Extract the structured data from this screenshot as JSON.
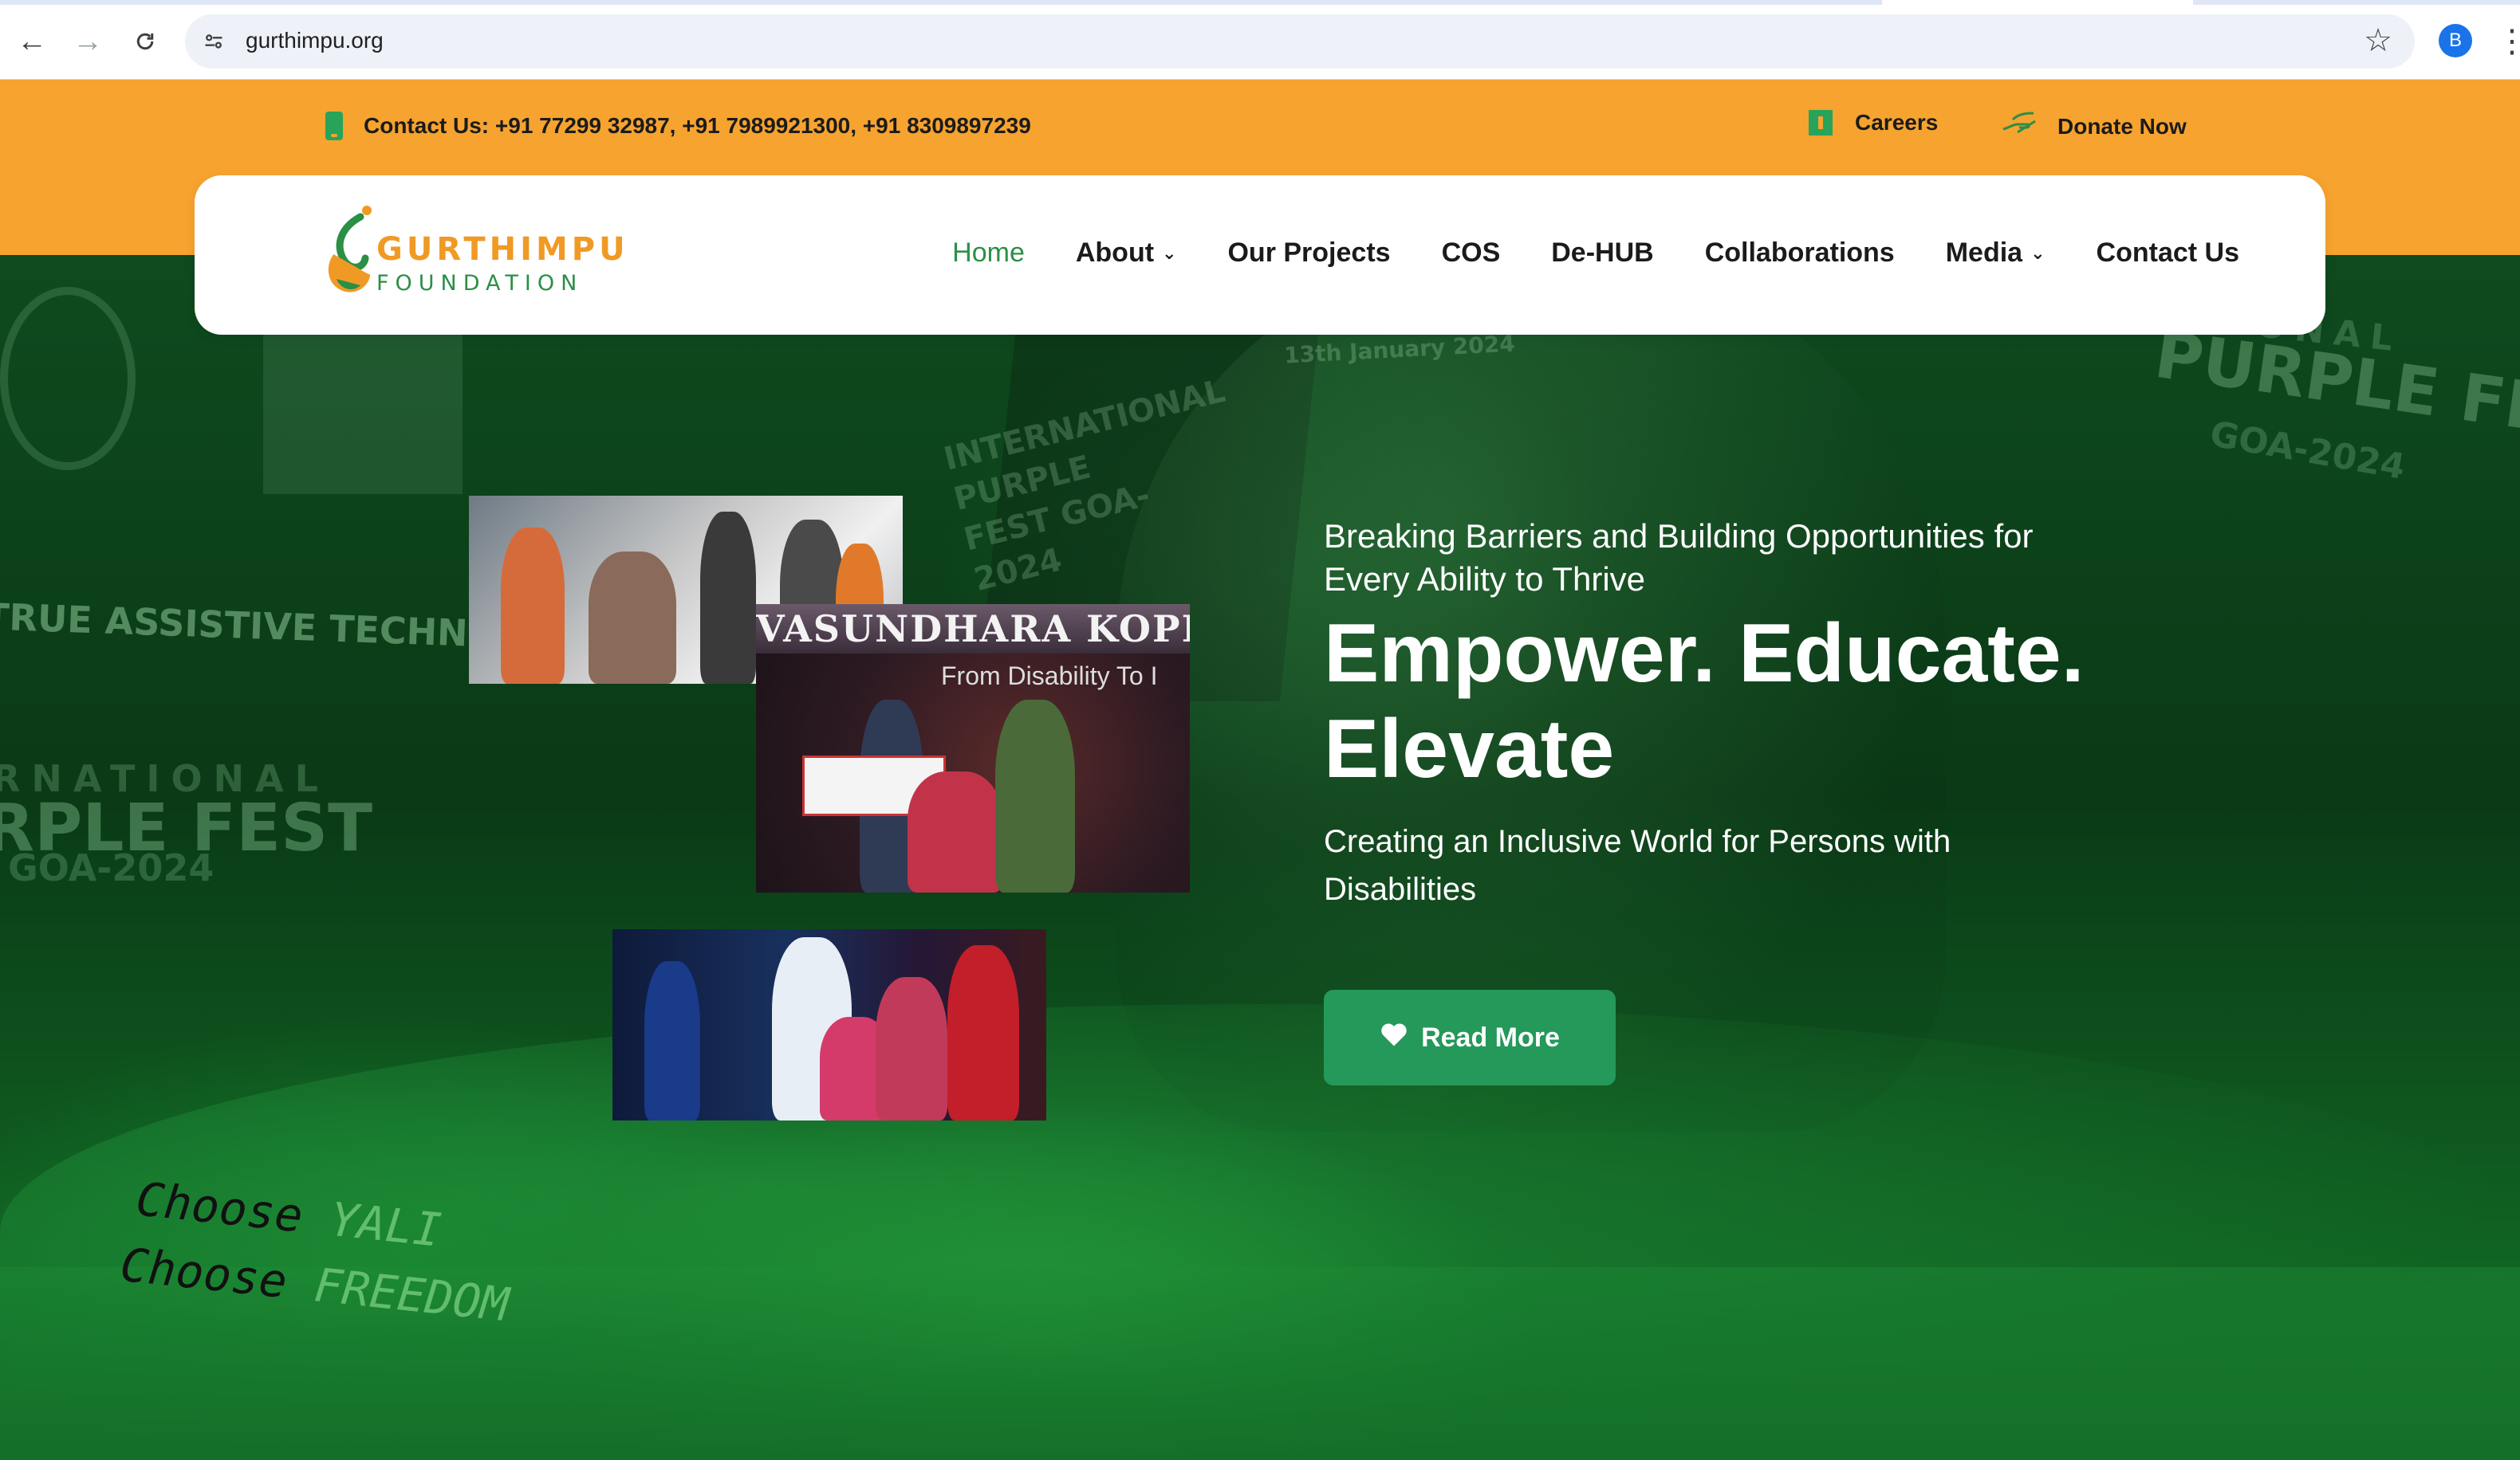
{
  "browser": {
    "url": "gurthimpu.org",
    "profile_initial": "B"
  },
  "topbar": {
    "contact_text": "Contact Us: +91 77299 32987, +91 7989921300, +91 8309897239",
    "careers_label": "Careers",
    "donate_label": "Donate Now"
  },
  "header": {
    "logo_line1": "GURTHIMPU",
    "logo_line2": "FOUNDATION",
    "menu": [
      {
        "label": "Home"
      },
      {
        "label": "About"
      },
      {
        "label": "Our Projects"
      },
      {
        "label": "COS"
      },
      {
        "label": "De-HUB"
      },
      {
        "label": "Collaborations"
      },
      {
        "label": "Media"
      },
      {
        "label": "Contact Us"
      }
    ]
  },
  "hero": {
    "kicker": "Breaking Barriers and Building Opportunities for Every Ability to Thrive",
    "headline": "Empower. Educate. Elevate",
    "subline": "Creating an Inclusive World for Persons with Disabilities",
    "cta_label": "Read More",
    "bg_texts": {
      "assistive": "TRUE ASSISTIVE TECHNOLOGY",
      "intl_left": "RNATIONAL",
      "fest_left": "RPLE FEST",
      "goa_left": "GOA-2024",
      "intl_right": "IONAL",
      "fest_right": "PURPLE FEST",
      "goa_right": "GOA-2024",
      "date": "13th January 2024",
      "banner_mid": "INTERNATIONAL PURPLE FEST GOA-2024",
      "choose_1a": "Choose",
      "choose_1b": "YALI",
      "choose_2a": "Choose",
      "choose_2b": "FREEDOM"
    },
    "photo2_banner": "VASUNDHARA KOPPU",
    "photo2_sub": "From Disability To I"
  },
  "colors": {
    "orange": "#f6a330",
    "green_accent": "#2b8f46",
    "button_green": "#24995a"
  }
}
